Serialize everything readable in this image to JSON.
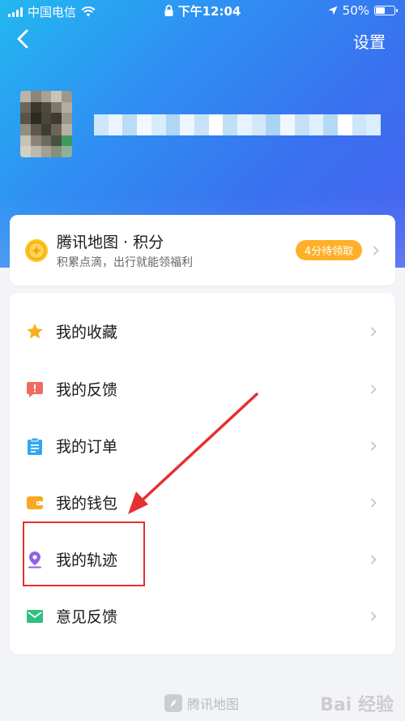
{
  "status_bar": {
    "carrier": "中国电信",
    "time": "下午12:04",
    "battery": "50%",
    "battery_level": 0.5
  },
  "nav": {
    "settings_label": "设置"
  },
  "points": {
    "title": "腾讯地图 · 积分",
    "subtitle": "积累点滴，出行就能领福利",
    "badge": "4分待领取"
  },
  "menu": {
    "items": [
      {
        "label": "我的收藏",
        "icon": "star-icon",
        "color": "#f7b11e"
      },
      {
        "label": "我的反馈",
        "icon": "feedback-icon",
        "color": "#f06a62"
      },
      {
        "label": "我的订单",
        "icon": "clipboard-icon",
        "color": "#2fa8f2"
      },
      {
        "label": "我的钱包",
        "icon": "wallet-icon",
        "color": "#f9a823"
      },
      {
        "label": "我的轨迹",
        "icon": "location-pin-icon",
        "color": "#8d63e8"
      },
      {
        "label": "意见反馈",
        "icon": "mail-icon",
        "color": "#2fc07e"
      }
    ]
  },
  "footer": {
    "brand": "腾讯地图"
  },
  "watermark": "Bai 经验",
  "colors": {
    "hero_start": "#22b8f0",
    "hero_end": "#4a63f2",
    "badge": "#ffb02a",
    "annotation": "#e53030"
  }
}
